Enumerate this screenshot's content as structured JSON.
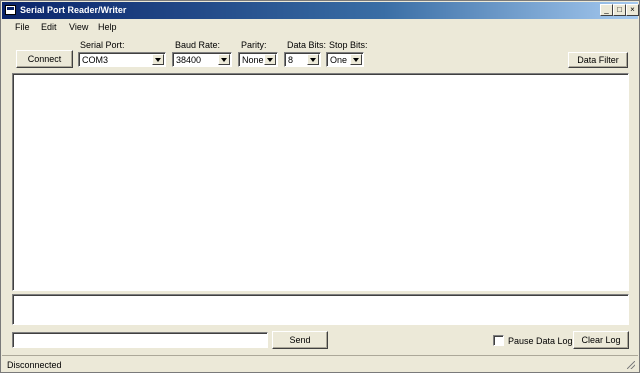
{
  "window": {
    "title": "Serial Port Reader/Writer",
    "buttons": {
      "minimize": "_",
      "maximize": "□",
      "close": "×"
    }
  },
  "menu": {
    "items": [
      "File",
      "Edit",
      "View",
      "Help"
    ]
  },
  "toolbar": {
    "connect_label": "Connect",
    "data_filter_label": "Data Filter",
    "serial_port": {
      "label": "Serial Port:",
      "value": "COM3"
    },
    "baud_rate": {
      "label": "Baud Rate:",
      "value": "38400"
    },
    "parity": {
      "label": "Parity:",
      "value": "None"
    },
    "data_bits": {
      "label": "Data Bits:",
      "value": "8"
    },
    "stop_bits": {
      "label": "Stop Bits:",
      "value": "One"
    }
  },
  "bottom": {
    "send_input_value": "",
    "send_label": "Send",
    "pause_label": "Pause Data Log",
    "pause_checked": false,
    "clear_log_label": "Clear Log"
  },
  "status": {
    "text": "Disconnected"
  }
}
